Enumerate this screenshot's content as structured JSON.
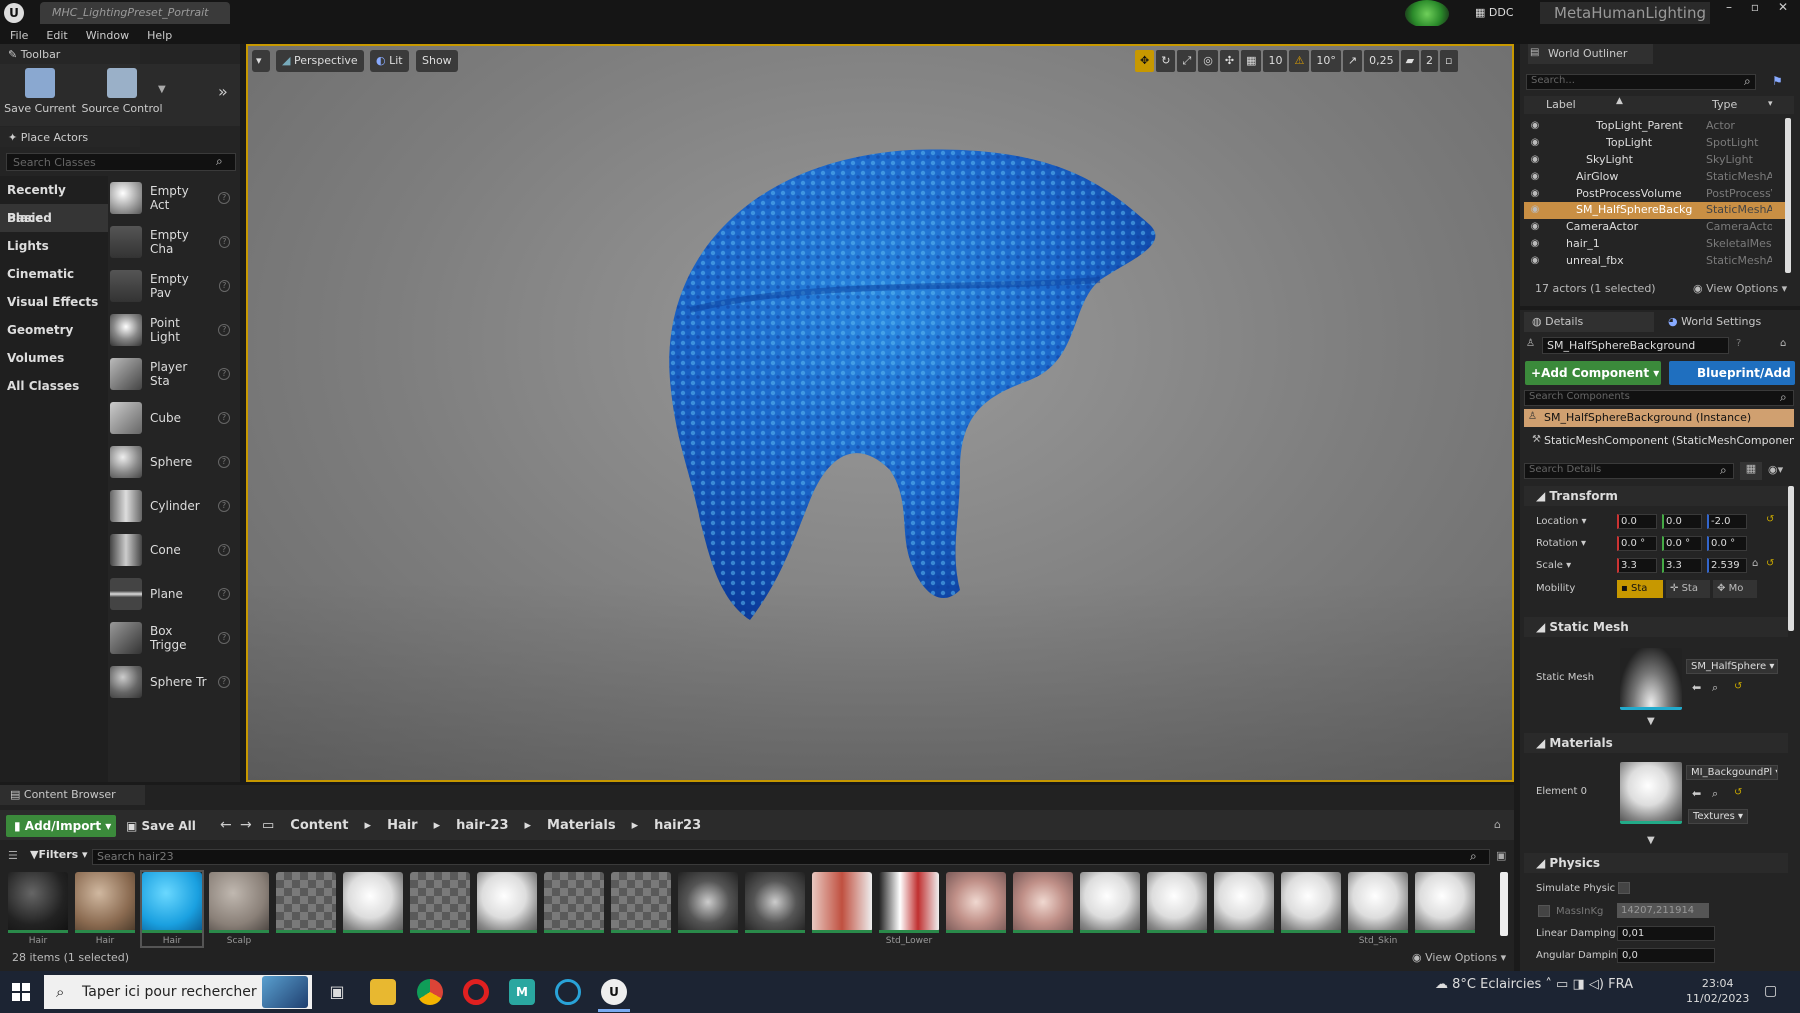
{
  "titlebar": {
    "document_tab": "MHC_LightingPreset_Portrait",
    "ddc_label": "DDC",
    "app_name": "MetaHumanLighting"
  },
  "menu": [
    "File",
    "Edit",
    "Window",
    "Help"
  ],
  "toolbar": {
    "panel_title": "Toolbar",
    "save_current": "Save Current",
    "source_control": "Source Control"
  },
  "place_actors": {
    "panel_title": "Place Actors",
    "search_placeholder": "Search Classes",
    "categories": [
      "Recently Placed",
      "Basic",
      "Lights",
      "Cinematic",
      "Visual Effects",
      "Geometry",
      "Volumes",
      "All Classes"
    ],
    "selected_category": "Basic",
    "actors": [
      "Empty Act",
      "Empty Cha",
      "Empty Pav",
      "Point Light",
      "Player Sta",
      "Cube",
      "Sphere",
      "Cylinder",
      "Cone",
      "Plane",
      "Box Trigge",
      "Sphere Tr"
    ]
  },
  "viewport": {
    "perspective": "Perspective",
    "lit": "Lit",
    "show": "Show",
    "grid_snap": "10",
    "rotation_snap": "10°",
    "scale_snap": "0,25",
    "camera_speed": "2"
  },
  "content_browser": {
    "tab": "Content Browser",
    "add_import": "Add/Import",
    "save_all": "Save All",
    "breadcrumb": [
      "Content",
      "Hair",
      "hair-23",
      "Materials",
      "hair23"
    ],
    "filters": "Filters",
    "search_placeholder": "Search hair23",
    "status": "28 items (1 selected)",
    "view_options": "View Options",
    "assets": [
      {
        "label": "Hair",
        "kind": "dark-sphere"
      },
      {
        "label": "Hair",
        "kind": "brown-sphere"
      },
      {
        "label": "Hair",
        "kind": "blue-sphere"
      },
      {
        "label": "Scalp",
        "kind": "grey-sphere"
      },
      {
        "label": "",
        "kind": "checker"
      },
      {
        "label": "",
        "kind": "white-sphere"
      },
      {
        "label": "",
        "kind": "checker"
      },
      {
        "label": "",
        "kind": "white-sphere"
      },
      {
        "label": "",
        "kind": "checker"
      },
      {
        "label": "",
        "kind": "checker"
      },
      {
        "label": "",
        "kind": "hair-clip"
      },
      {
        "label": "",
        "kind": "hair-clip"
      },
      {
        "label": "",
        "kind": "pink-face"
      },
      {
        "label": "Std_Lower",
        "kind": "red-face"
      },
      {
        "label": "",
        "kind": "face-map"
      },
      {
        "label": "",
        "kind": "face-map"
      },
      {
        "label": "",
        "kind": "white-sphere"
      },
      {
        "label": "",
        "kind": "white-sphere"
      },
      {
        "label": "",
        "kind": "white-sphere"
      },
      {
        "label": "",
        "kind": "white-sphere"
      },
      {
        "label": "Std_Skin",
        "kind": "white-sphere"
      },
      {
        "label": "",
        "kind": "white-sphere"
      }
    ]
  },
  "world_outliner": {
    "tab": "World Outliner",
    "search_placeholder": "Search...",
    "col_label": "Label",
    "col_type": "Type",
    "rows": [
      {
        "label": "TopLight_Parent",
        "type": "Actor",
        "indent": 3,
        "selected": false
      },
      {
        "label": "TopLight",
        "type": "SpotLight",
        "indent": 4,
        "selected": false
      },
      {
        "label": "SkyLight",
        "type": "SkyLight",
        "indent": 2,
        "selected": false
      },
      {
        "label": "AirGlow",
        "type": "StaticMeshAc",
        "indent": 1,
        "selected": false
      },
      {
        "label": "PostProcessVolume",
        "type": "PostProcessV",
        "indent": 1,
        "selected": false
      },
      {
        "label": "SM_HalfSphereBackg",
        "type": "StaticMeshAc",
        "indent": 1,
        "selected": true
      },
      {
        "label": "CameraActor",
        "type": "CameraActor",
        "indent": 0,
        "selected": false
      },
      {
        "label": "hair_1",
        "type": "SkeletalMesh",
        "indent": 0,
        "selected": false
      },
      {
        "label": "unreal_fbx",
        "type": "StaticMeshAc",
        "indent": 0,
        "selected": false
      }
    ],
    "status": "17 actors (1 selected)",
    "view_options": "View Options"
  },
  "details": {
    "tab": "Details",
    "world_settings_tab": "World Settings",
    "object_name": "SM_HalfSphereBackground",
    "add_component": "Add Component",
    "blueprint": "Blueprint/Add",
    "search_components": "Search Components",
    "instance_row": "SM_HalfSphereBackground (Instance)",
    "component_row": "StaticMeshComponent (StaticMeshComponent",
    "search_details": "Search Details",
    "transform": {
      "title": "Transform",
      "location_label": "Location",
      "rotation_label": "Rotation",
      "scale_label": "Scale",
      "mobility_label": "Mobility",
      "location": [
        "0.0",
        "0.0",
        "-2.0"
      ],
      "rotation": [
        "0.0 °",
        "0.0 °",
        "0.0 °"
      ],
      "scale": [
        "3.3",
        "3.3",
        "2.539"
      ],
      "mobility": [
        "Sta",
        "Sta",
        "Mo"
      ]
    },
    "static_mesh": {
      "title": "Static Mesh",
      "label": "Static Mesh",
      "value": "SM_HalfSphere"
    },
    "materials": {
      "title": "Materials",
      "label": "Element 0",
      "value": "MI_BackgoundPl",
      "textures": "Textures"
    },
    "physics": {
      "title": "Physics",
      "simulate_label": "Simulate Physic",
      "mass_label": "MassInKg",
      "mass_value": "14207,211914",
      "linear_label": "Linear Damping",
      "linear_value": "0,01",
      "angular_label": "Angular Dampin",
      "angular_value": "0,0"
    }
  },
  "taskbar": {
    "search_placeholder": "Taper ici pour rechercher",
    "weather": "8°C  Eclaircies",
    "lang": "FRA",
    "time": "23:04",
    "date": "11/02/2023"
  },
  "colors": {
    "accent_orange": "#c79800",
    "add_green": "#3b8a3b",
    "blueprint_blue": "#1f6fbf",
    "selected_row": "#c98f44",
    "hair_blue": "#1e6fd0"
  }
}
